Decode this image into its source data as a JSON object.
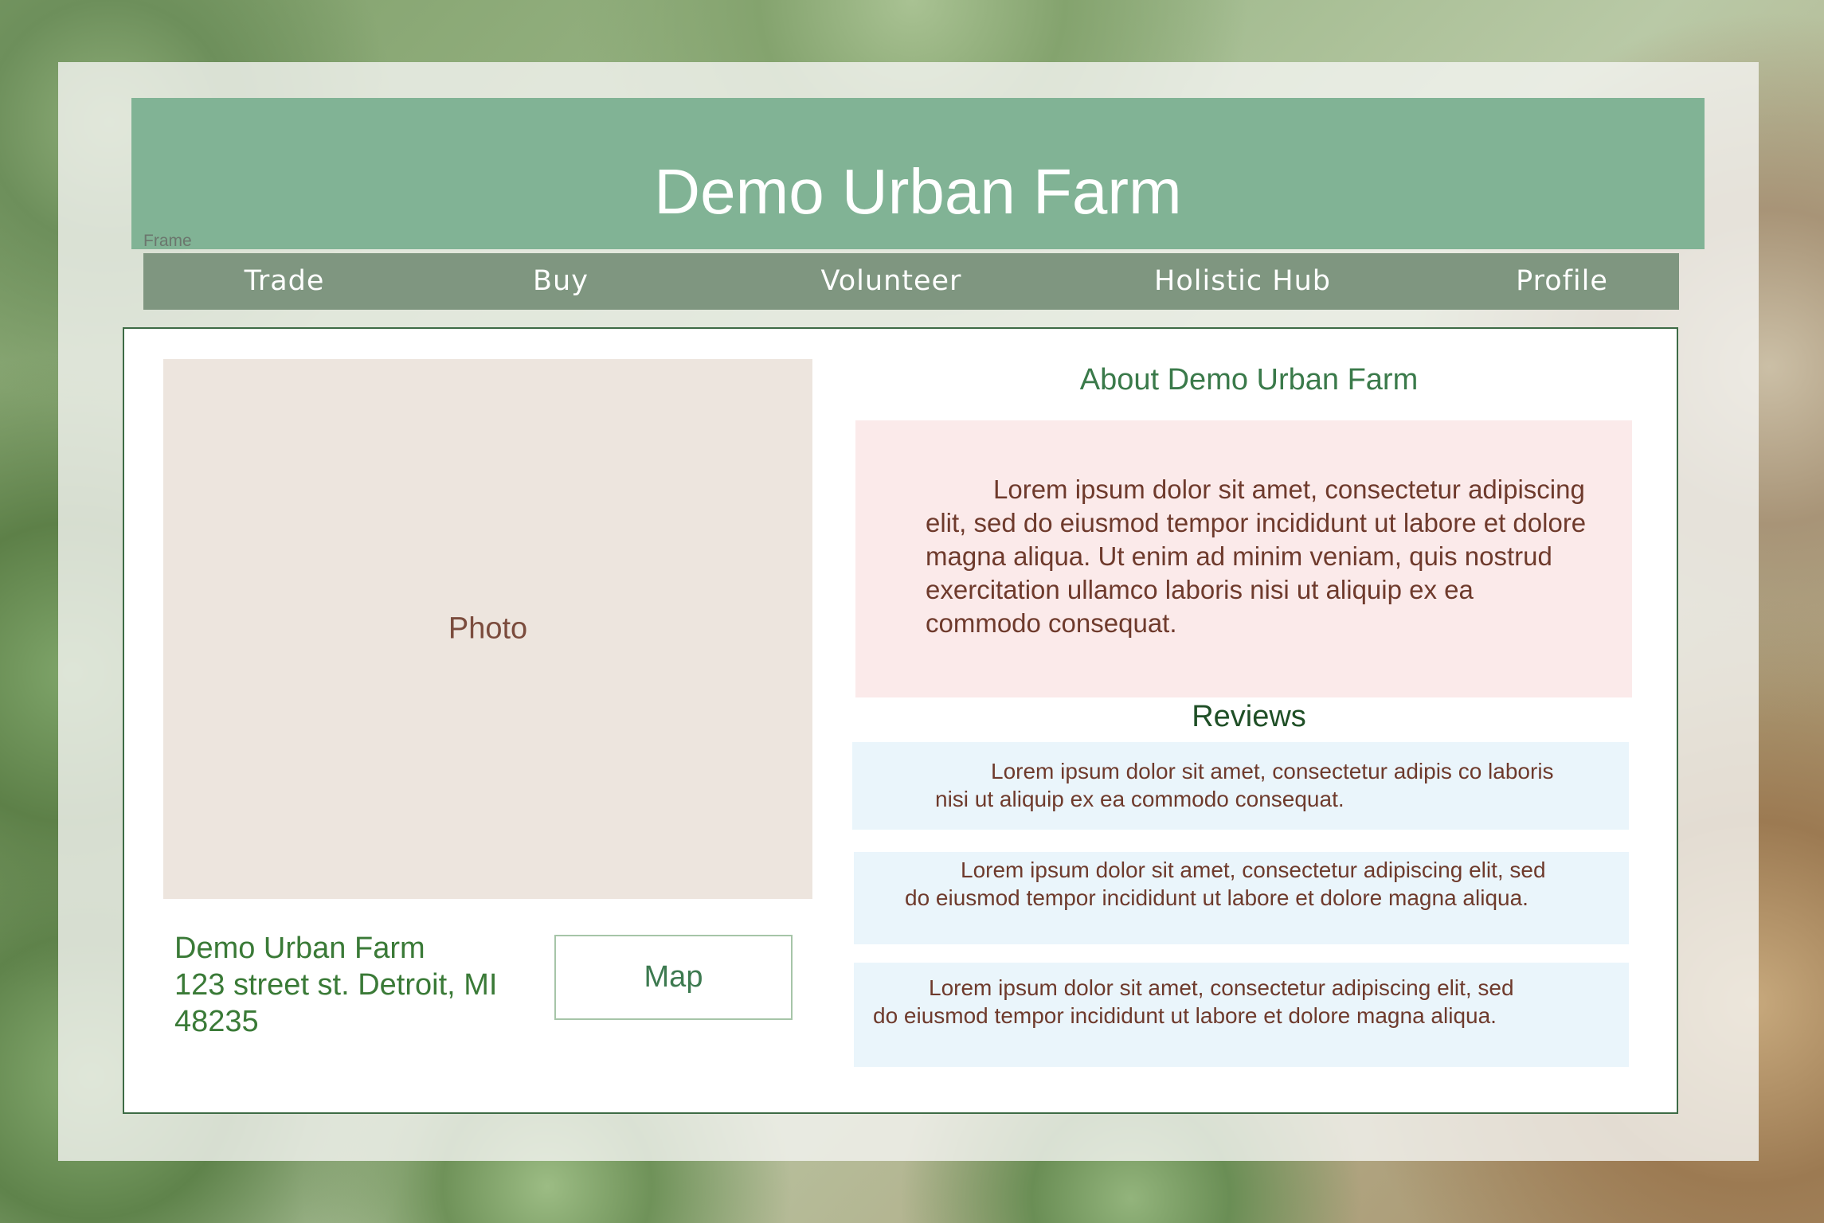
{
  "header": {
    "title": "Demo Urban Farm",
    "frame_label": "Frame"
  },
  "nav": {
    "items": [
      {
        "label": "Trade"
      },
      {
        "label": "Buy"
      },
      {
        "label": "Volunteer"
      },
      {
        "label": "Holistic Hub"
      },
      {
        "label": "Profile"
      }
    ]
  },
  "photo": {
    "label": "Photo"
  },
  "farm": {
    "name": "Demo Urban Farm",
    "street": "123 street st. Detroit, MI",
    "zip": "48235",
    "map_label": "Map"
  },
  "about": {
    "heading": "About Demo Urban Farm",
    "text": "Lorem ipsum dolor sit amet, consectetur adipiscing elit, sed do eiusmod tempor incididunt ut labore et dolore magna aliqua. Ut enim ad minim veniam, quis nostrud exercitation ullamco laboris nisi ut aliquip ex ea commodo consequat."
  },
  "reviews": {
    "heading": "Reviews",
    "items": [
      {
        "text": "Lorem ipsum dolor sit amet, consectetur adipis co laboris nisi ut aliquip ex ea commodo consequat."
      },
      {
        "text": "Lorem ipsum dolor sit amet, consectetur adipiscing elit, sed do eiusmod tempor incididunt ut labore et dolore magna aliqua."
      },
      {
        "text": "Lorem ipsum dolor sit amet, consectetur adipiscing elit, sed do eiusmod tempor incididunt ut labore et dolore magna aliqua."
      }
    ]
  },
  "colors": {
    "header_green": "#81b395",
    "nav_green": "#7f9680",
    "photo_placeholder": "#ede5de",
    "about_bg": "#fbeaea",
    "review_bg": "#eaf5fb",
    "text_brown": "#6e3a2c",
    "text_green": "#3a7a37"
  }
}
